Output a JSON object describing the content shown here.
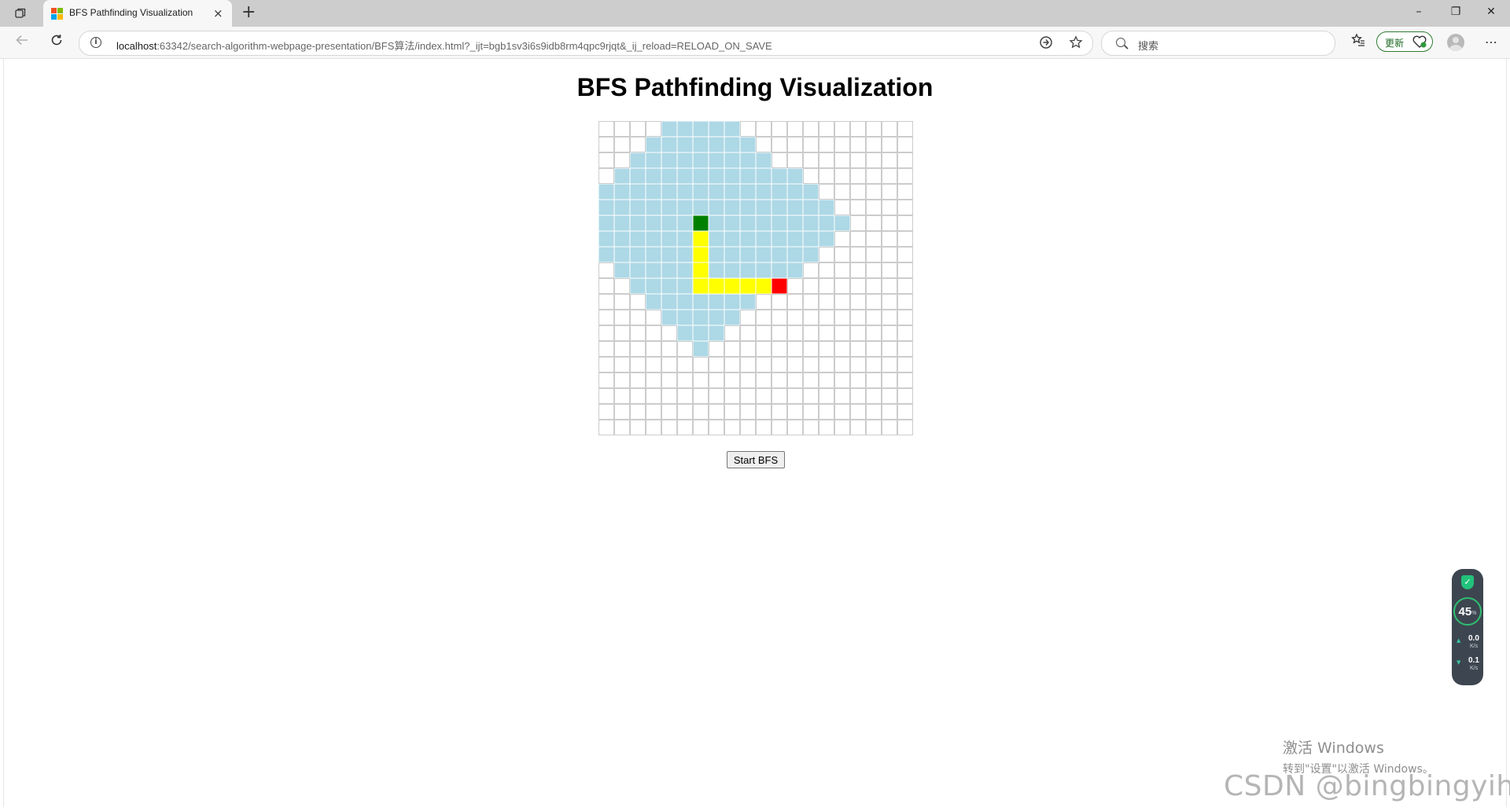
{
  "browser": {
    "tab_title": "BFS Pathfinding Visualization",
    "tab_close_glyph": "×",
    "new_tab_glyph": "+",
    "url_host": "localhost",
    "url_rest": ":63342/search-algorithm-webpage-presentation/BFS算法/index.html?_ijt=bgb1sv3i6s9idb8rm4qpc9rjqt&_ij_reload=RELOAD_ON_SAVE",
    "search_placeholder": "搜索",
    "update_label": "更新",
    "window": {
      "minimize": "–",
      "restore": "❐",
      "close": "✕"
    },
    "icons": [
      "tab-actions-icon",
      "back-arrow-icon",
      "reload-icon",
      "info-icon",
      "translate-icon",
      "favorite-star-icon",
      "search-icon",
      "collections-icon",
      "heart-pulse-icon",
      "avatar",
      "more-icon"
    ]
  },
  "page": {
    "title": "BFS Pathfinding Visualization",
    "button_label": "Start BFS"
  },
  "grid": {
    "rows": 20,
    "cols": 20,
    "colors": {
      "empty": "#ffffff",
      "visited": "#add8e6",
      "path": "#ffff00",
      "start": "#008000",
      "end": "#ff0000",
      "line": "#cccccc"
    },
    "visited_spans": [
      [
        0,
        4,
        8
      ],
      [
        1,
        3,
        9
      ],
      [
        2,
        2,
        10
      ],
      [
        3,
        1,
        12
      ],
      [
        4,
        0,
        13
      ],
      [
        5,
        0,
        14
      ],
      [
        6,
        0,
        15
      ],
      [
        7,
        0,
        14
      ],
      [
        8,
        0,
        13
      ],
      [
        9,
        1,
        12
      ],
      [
        10,
        2,
        11
      ],
      [
        11,
        3,
        9
      ],
      [
        12,
        4,
        8
      ],
      [
        13,
        5,
        7
      ],
      [
        14,
        6,
        6
      ]
    ],
    "path_cells": [
      [
        7,
        6
      ],
      [
        8,
        6
      ],
      [
        9,
        6
      ],
      [
        10,
        6
      ],
      [
        10,
        7
      ],
      [
        10,
        8
      ],
      [
        10,
        9
      ],
      [
        10,
        10
      ]
    ],
    "start_cell": [
      6,
      6
    ],
    "end_cell": [
      10,
      11
    ]
  },
  "overlay": {
    "cpu_percent": "45",
    "cpu_unit": "%",
    "upload_value": "0.0",
    "upload_unit": "K/s",
    "download_value": "0.1",
    "download_unit": "K/s",
    "activate_line1": "激活 Windows",
    "activate_line2": "转到\"设置\"以激活 Windows。",
    "watermark": "CSDN @bingbingyihao"
  }
}
